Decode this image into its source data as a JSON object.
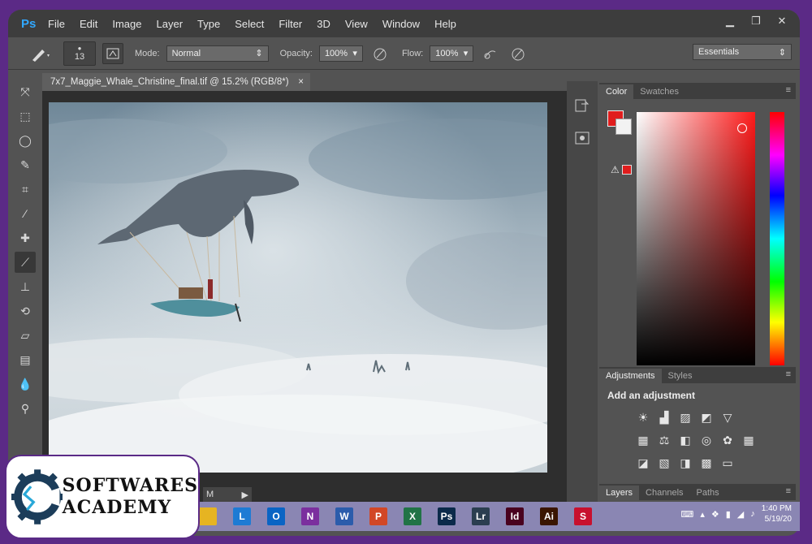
{
  "app": {
    "logo": "Ps"
  },
  "menu": [
    "File",
    "Edit",
    "Image",
    "Layer",
    "Type",
    "Select",
    "Filter",
    "3D",
    "View",
    "Window",
    "Help"
  ],
  "window_controls": {
    "minimize": "▁",
    "restore": "❐",
    "close": "✕"
  },
  "options": {
    "brush_size": "13",
    "mode_label": "Mode:",
    "mode_value": "Normal",
    "opacity_label": "Opacity:",
    "opacity_value": "100%",
    "flow_label": "Flow:",
    "flow_value": "100%",
    "workspace": "Essentials"
  },
  "tools": [
    "move-icon",
    "marquee-icon",
    "lasso-icon",
    "quick-select-icon",
    "crop-icon",
    "eyedropper-icon",
    "healing-icon",
    "brush-icon",
    "stamp-icon",
    "history-brush-icon",
    "eraser-icon",
    "gradient-icon",
    "blur-icon",
    "dodge-icon"
  ],
  "document": {
    "tab_title": "7x7_Maggie_Whale_Christine_final.tif @ 15.2% (RGB/8*)",
    "tab_close": "×",
    "status": "M"
  },
  "panels": {
    "color_tabs": [
      "Color",
      "Swatches"
    ],
    "adjust_tabs": [
      "Adjustments",
      "Styles"
    ],
    "adjust_title": "Add an adjustment",
    "layers_tabs": [
      "Layers",
      "Channels",
      "Paths"
    ],
    "fg_color": "#e01d1d",
    "bg_color": "#f2f2f2"
  },
  "taskbar": {
    "apps": [
      {
        "name": "file-explorer-icon",
        "label": "",
        "color": "#e6b422"
      },
      {
        "name": "lync-icon",
        "label": "L",
        "color": "#1e7bd4"
      },
      {
        "name": "outlook-icon",
        "label": "O",
        "color": "#0a64c4"
      },
      {
        "name": "onenote-icon",
        "label": "N",
        "color": "#7b2f9e"
      },
      {
        "name": "word-icon",
        "label": "W",
        "color": "#2b5cab"
      },
      {
        "name": "powerpoint-icon",
        "label": "P",
        "color": "#d24726"
      },
      {
        "name": "excel-icon",
        "label": "X",
        "color": "#217346"
      },
      {
        "name": "photoshop-icon",
        "label": "Ps",
        "color": "#0b2a4a"
      },
      {
        "name": "lightroom-icon",
        "label": "Lr",
        "color": "#2b3e50"
      },
      {
        "name": "indesign-icon",
        "label": "Id",
        "color": "#49021f"
      },
      {
        "name": "illustrator-icon",
        "label": "Ai",
        "color": "#3a1500"
      },
      {
        "name": "snagit-icon",
        "label": "S",
        "color": "#c8102e"
      }
    ],
    "time": "1:40 PM",
    "date": "5/19/20"
  },
  "watermark": {
    "line1": "SOFTWARES",
    "line2": "ACADEMY"
  }
}
